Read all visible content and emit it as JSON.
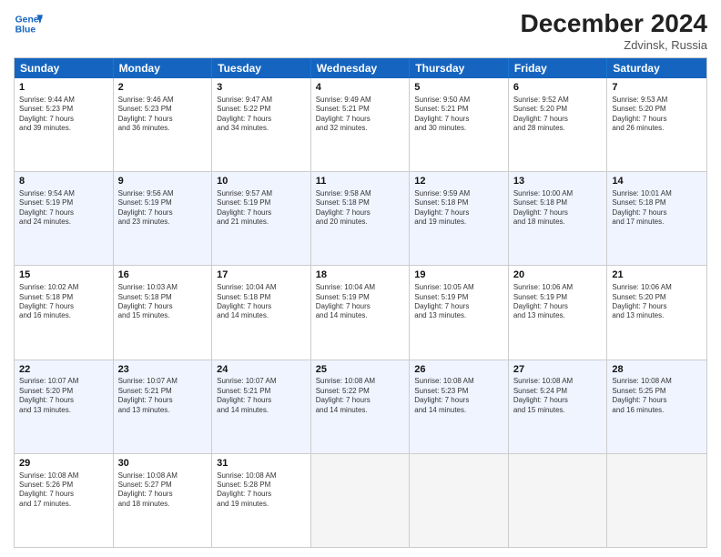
{
  "header": {
    "logo_line1": "General",
    "logo_line2": "Blue",
    "month": "December 2024",
    "location": "Zdvinsk, Russia"
  },
  "weekdays": [
    "Sunday",
    "Monday",
    "Tuesday",
    "Wednesday",
    "Thursday",
    "Friday",
    "Saturday"
  ],
  "rows": [
    [
      {
        "day": "1",
        "info": "Sunrise: 9:44 AM\nSunset: 5:23 PM\nDaylight: 7 hours\nand 39 minutes."
      },
      {
        "day": "2",
        "info": "Sunrise: 9:46 AM\nSunset: 5:23 PM\nDaylight: 7 hours\nand 36 minutes."
      },
      {
        "day": "3",
        "info": "Sunrise: 9:47 AM\nSunset: 5:22 PM\nDaylight: 7 hours\nand 34 minutes."
      },
      {
        "day": "4",
        "info": "Sunrise: 9:49 AM\nSunset: 5:21 PM\nDaylight: 7 hours\nand 32 minutes."
      },
      {
        "day": "5",
        "info": "Sunrise: 9:50 AM\nSunset: 5:21 PM\nDaylight: 7 hours\nand 30 minutes."
      },
      {
        "day": "6",
        "info": "Sunrise: 9:52 AM\nSunset: 5:20 PM\nDaylight: 7 hours\nand 28 minutes."
      },
      {
        "day": "7",
        "info": "Sunrise: 9:53 AM\nSunset: 5:20 PM\nDaylight: 7 hours\nand 26 minutes."
      }
    ],
    [
      {
        "day": "8",
        "info": "Sunrise: 9:54 AM\nSunset: 5:19 PM\nDaylight: 7 hours\nand 24 minutes."
      },
      {
        "day": "9",
        "info": "Sunrise: 9:56 AM\nSunset: 5:19 PM\nDaylight: 7 hours\nand 23 minutes."
      },
      {
        "day": "10",
        "info": "Sunrise: 9:57 AM\nSunset: 5:19 PM\nDaylight: 7 hours\nand 21 minutes."
      },
      {
        "day": "11",
        "info": "Sunrise: 9:58 AM\nSunset: 5:18 PM\nDaylight: 7 hours\nand 20 minutes."
      },
      {
        "day": "12",
        "info": "Sunrise: 9:59 AM\nSunset: 5:18 PM\nDaylight: 7 hours\nand 19 minutes."
      },
      {
        "day": "13",
        "info": "Sunrise: 10:00 AM\nSunset: 5:18 PM\nDaylight: 7 hours\nand 18 minutes."
      },
      {
        "day": "14",
        "info": "Sunrise: 10:01 AM\nSunset: 5:18 PM\nDaylight: 7 hours\nand 17 minutes."
      }
    ],
    [
      {
        "day": "15",
        "info": "Sunrise: 10:02 AM\nSunset: 5:18 PM\nDaylight: 7 hours\nand 16 minutes."
      },
      {
        "day": "16",
        "info": "Sunrise: 10:03 AM\nSunset: 5:18 PM\nDaylight: 7 hours\nand 15 minutes."
      },
      {
        "day": "17",
        "info": "Sunrise: 10:04 AM\nSunset: 5:18 PM\nDaylight: 7 hours\nand 14 minutes."
      },
      {
        "day": "18",
        "info": "Sunrise: 10:04 AM\nSunset: 5:19 PM\nDaylight: 7 hours\nand 14 minutes."
      },
      {
        "day": "19",
        "info": "Sunrise: 10:05 AM\nSunset: 5:19 PM\nDaylight: 7 hours\nand 13 minutes."
      },
      {
        "day": "20",
        "info": "Sunrise: 10:06 AM\nSunset: 5:19 PM\nDaylight: 7 hours\nand 13 minutes."
      },
      {
        "day": "21",
        "info": "Sunrise: 10:06 AM\nSunset: 5:20 PM\nDaylight: 7 hours\nand 13 minutes."
      }
    ],
    [
      {
        "day": "22",
        "info": "Sunrise: 10:07 AM\nSunset: 5:20 PM\nDaylight: 7 hours\nand 13 minutes."
      },
      {
        "day": "23",
        "info": "Sunrise: 10:07 AM\nSunset: 5:21 PM\nDaylight: 7 hours\nand 13 minutes."
      },
      {
        "day": "24",
        "info": "Sunrise: 10:07 AM\nSunset: 5:21 PM\nDaylight: 7 hours\nand 14 minutes."
      },
      {
        "day": "25",
        "info": "Sunrise: 10:08 AM\nSunset: 5:22 PM\nDaylight: 7 hours\nand 14 minutes."
      },
      {
        "day": "26",
        "info": "Sunrise: 10:08 AM\nSunset: 5:23 PM\nDaylight: 7 hours\nand 14 minutes."
      },
      {
        "day": "27",
        "info": "Sunrise: 10:08 AM\nSunset: 5:24 PM\nDaylight: 7 hours\nand 15 minutes."
      },
      {
        "day": "28",
        "info": "Sunrise: 10:08 AM\nSunset: 5:25 PM\nDaylight: 7 hours\nand 16 minutes."
      }
    ],
    [
      {
        "day": "29",
        "info": "Sunrise: 10:08 AM\nSunset: 5:26 PM\nDaylight: 7 hours\nand 17 minutes."
      },
      {
        "day": "30",
        "info": "Sunrise: 10:08 AM\nSunset: 5:27 PM\nDaylight: 7 hours\nand 18 minutes."
      },
      {
        "day": "31",
        "info": "Sunrise: 10:08 AM\nSunset: 5:28 PM\nDaylight: 7 hours\nand 19 minutes."
      },
      {
        "day": "",
        "info": ""
      },
      {
        "day": "",
        "info": ""
      },
      {
        "day": "",
        "info": ""
      },
      {
        "day": "",
        "info": ""
      }
    ]
  ],
  "alt_rows": [
    1,
    3
  ]
}
